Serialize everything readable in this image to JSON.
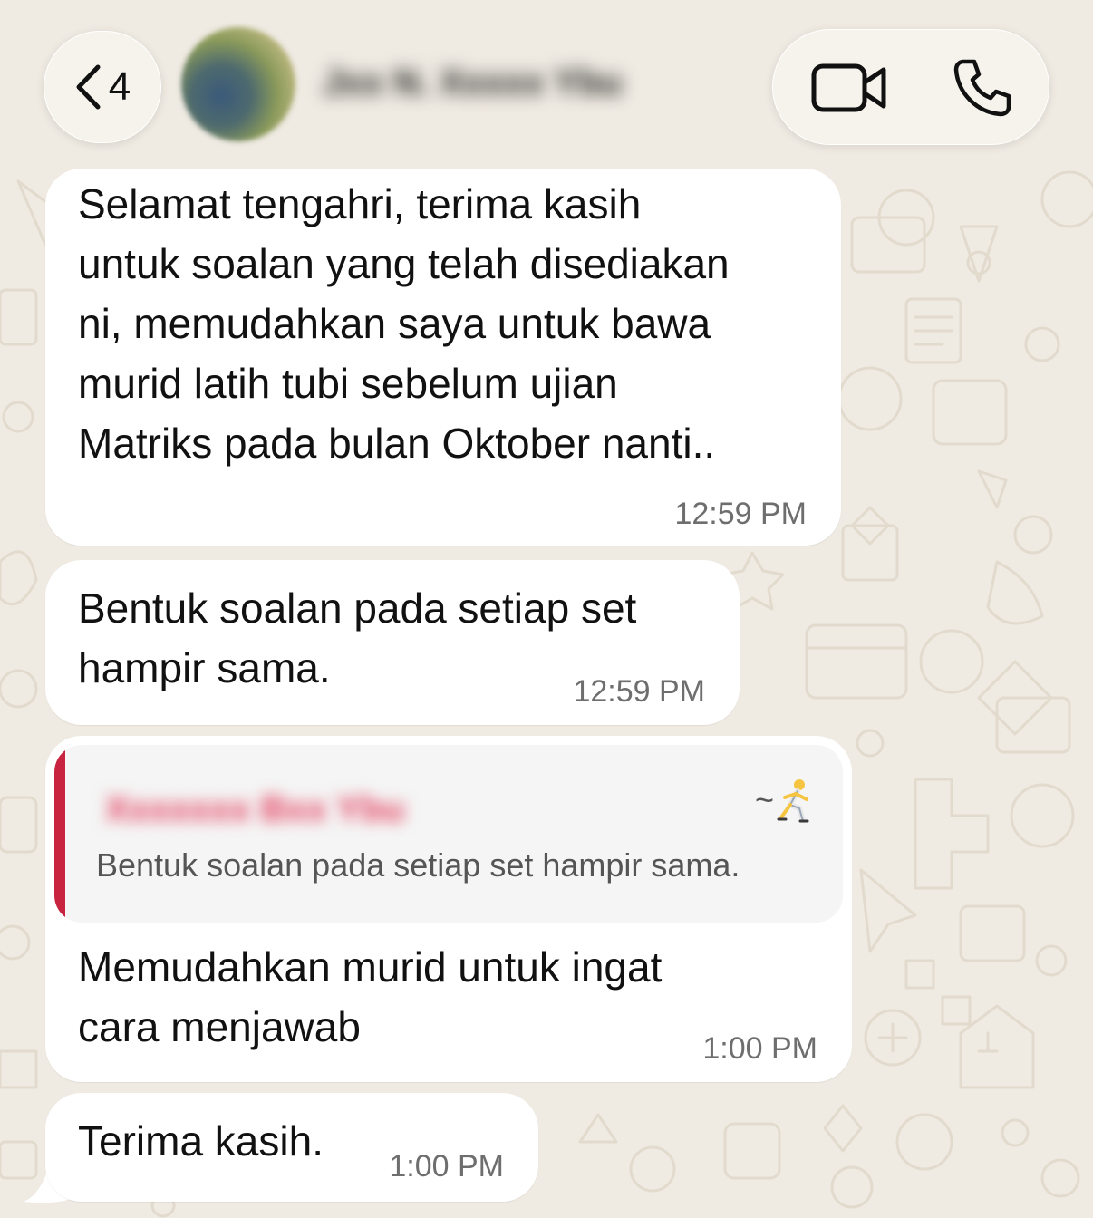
{
  "header": {
    "back_count": "4",
    "contact_name": "Jxx N. Xxxxx Ybu",
    "icons": [
      "back-chevron-icon",
      "avatar",
      "video-call-icon",
      "phone-call-icon"
    ]
  },
  "messages": [
    {
      "text": "Selamat tengahri, terima kasih\nuntuk soalan yang telah disediakan\nni, memudahkan saya untuk bawa\nmurid latih tubi sebelum ujian\nMatriks pada bulan Oktober nanti..",
      "time": "12:59 PM"
    },
    {
      "text": "Bentuk soalan pada setiap set\nhampir sama.",
      "time": "12:59 PM"
    },
    {
      "reply": {
        "author": "Xxxxxxx Bxx Ybu",
        "tag": "~",
        "tag_icon": "runner-emoji-icon",
        "text": "Bentuk soalan pada setiap set hampir sama."
      },
      "text": "Memudahkan murid untuk ingat\ncara menjawab",
      "time": "1:00 PM"
    },
    {
      "text": "Terima kasih.",
      "time": "1:00 PM"
    }
  ],
  "colors": {
    "chat_background": "#efeae2",
    "bubble": "#ffffff",
    "quote_bar": "#c8243f",
    "quote_author": "#e23d5c",
    "timestamp": "#6e6e6e"
  }
}
